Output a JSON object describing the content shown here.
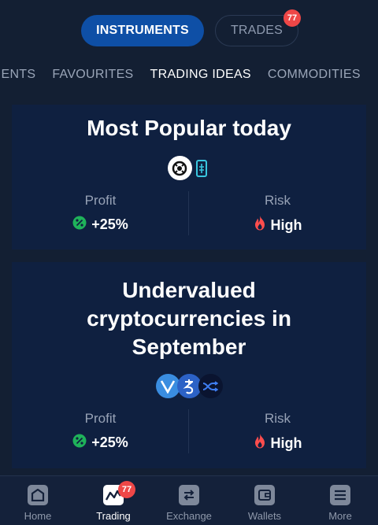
{
  "segments": {
    "instruments": "INSTRUMENTS",
    "trades": "TRADES",
    "trades_badge": "77"
  },
  "category_tabs": [
    {
      "label": "UMENTS"
    },
    {
      "label": "FAVOURITES"
    },
    {
      "label": "TRADING IDEAS",
      "active": true
    },
    {
      "label": "COMMODITIES"
    }
  ],
  "cards": [
    {
      "title": "Most Popular today",
      "coins": [
        "coin-ring-icon",
        "coin-tag-icon"
      ],
      "profit_label": "Profit",
      "profit_value": "+25%",
      "risk_label": "Risk",
      "risk_value": "High"
    },
    {
      "title_lines": [
        "Undervalued",
        "cryptocurrencies in",
        "September"
      ],
      "coins": [
        "vechain-icon",
        "tezos-icon",
        "shuffle-coin-icon"
      ],
      "profit_label": "Profit",
      "profit_value": "+25%",
      "risk_label": "Risk",
      "risk_value": "High"
    }
  ],
  "bottom_nav": [
    {
      "label": "Home",
      "icon": "home-icon"
    },
    {
      "label": "Trading",
      "icon": "trading-chart-icon",
      "active": true,
      "badge": "77"
    },
    {
      "label": "Exchange",
      "icon": "exchange-icon"
    },
    {
      "label": "Wallets",
      "icon": "wallet-icon"
    },
    {
      "label": "More",
      "icon": "menu-icon"
    }
  ],
  "colors": {
    "background": "#131f33",
    "card": "#0f2040",
    "accent": "#0e4fa6",
    "badge": "#ee4747",
    "profit": "#1fb25a",
    "risk": "#ff4d4d"
  }
}
